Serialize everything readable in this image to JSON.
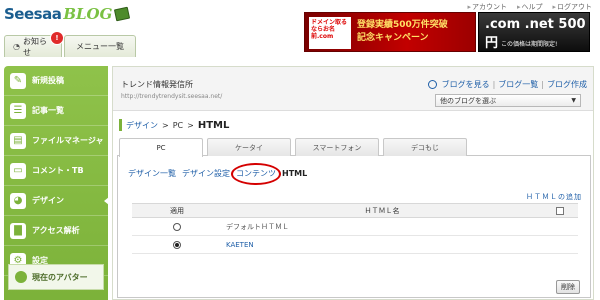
{
  "logo": {
    "main": "Seesaa",
    "sub": "BLOG"
  },
  "top_links": [
    "アカウント",
    "ヘルプ",
    "ログアウト"
  ],
  "tabs": {
    "news": "お知らせ",
    "menu": "メニュー一覧",
    "badge": "!"
  },
  "ads": {
    "ad1_logo": "ドメイン取るならお名前.com",
    "ad1_line1": "登録実績500万件突破",
    "ad1_line2": "記念キャンペーン",
    "ad2_top": ".com .net 500円",
    "ad2_bottom": "この価格は期間限定!"
  },
  "sidebar": {
    "items": [
      {
        "label": "新規投稿",
        "icon": "pencil-icon"
      },
      {
        "label": "記事一覧",
        "icon": "list-icon"
      },
      {
        "label": "ファイルマネージャ",
        "icon": "file-icon"
      },
      {
        "label": "コメント・TB",
        "icon": "comment-icon"
      },
      {
        "label": "デザイン",
        "icon": "palette-icon"
      },
      {
        "label": "アクセス解析",
        "icon": "chart-icon"
      },
      {
        "label": "設定",
        "icon": "gear-icon"
      }
    ],
    "avatar_label": "現在のアバター"
  },
  "blog": {
    "title": "トレンド情報発信所",
    "url": "http://trendytrendysit.seesaa.net/",
    "links": [
      "ブログを見る",
      "ブログ一覧",
      "ブログ作成"
    ],
    "select": "他のブログを選ぶ"
  },
  "breadcrumb": {
    "a": "デザイン",
    "b": "PC",
    "current": "HTML"
  },
  "device_tabs": [
    "PC",
    "ケータイ",
    "スマートフォン",
    "デコもじ"
  ],
  "subnav": {
    "a": "デザイン一覧",
    "b": "デザイン設定",
    "c": "コンテンツ",
    "current": "HTML"
  },
  "table": {
    "add_link": "ＨＴＭＬの追加",
    "header_apply": "適用",
    "header_name": "ＨＴＭＬ名",
    "rows": [
      {
        "name": "デフォルトＨＴＭＬ",
        "selected": false
      },
      {
        "name": "KAETEN",
        "selected": true
      }
    ],
    "delete": "削除"
  }
}
